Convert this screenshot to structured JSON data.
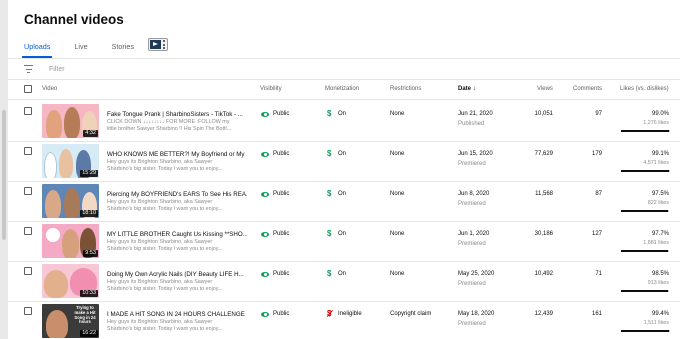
{
  "page": {
    "title": "Channel videos"
  },
  "tabs": [
    {
      "label": "Uploads",
      "active": true
    },
    {
      "label": "Live",
      "active": false
    },
    {
      "label": "Stories",
      "active": false
    }
  ],
  "filter": {
    "placeholder": "Filter"
  },
  "columns": {
    "video": "Video",
    "visibility": "Visibility",
    "monetization": "Monetization",
    "restrictions": "Restrictions",
    "date": "Date",
    "views": "Views",
    "comments": "Comments",
    "likes": "Likes (vs. dislikes)"
  },
  "colors": {
    "accent": "#065fd4",
    "green": "#0f9d58",
    "red": "#cc0000"
  },
  "rows": [
    {
      "title": "Fake Tongue Prank | SharbinoSisters - TikTok - ...",
      "desc1": "CLICK DOWN ↓↓↓↓↓↓↓↓ FOR MORE :FOLLOW my",
      "desc2": "little brother Sawyer Sharbino !! His Spin The Bottl...",
      "duration": "4:32",
      "visibility": "Public",
      "monetization": "On",
      "restrictions": "None",
      "date": "Jun 21, 2020",
      "status": "Published",
      "views": "10,051",
      "comments": "97",
      "likes_pct": "99.0%",
      "likes_count": "1,276 likes",
      "like_ratio": 0.99
    },
    {
      "title": "WHO KNOWS ME BETTER?! My Boyfriend or My ...",
      "desc1": "Hey guys its Brighton Sharbino, aka Sawyer",
      "desc2": "Sharbino's big sister. Today i want you to enjoy...",
      "duration": "15:29",
      "visibility": "Public",
      "monetization": "On",
      "restrictions": "None",
      "date": "Jun 15, 2020",
      "status": "Premiered",
      "views": "77,629",
      "comments": "179",
      "likes_pct": "99.1%",
      "likes_count": "4,571 likes",
      "like_ratio": 0.991
    },
    {
      "title": "Piercing My BOYFRIEND's EARS To See His REA...",
      "desc1": "Hey guys its Brighton Sharbino, aka Sawyer",
      "desc2": "Sharbino's big sister. Today i want you to enjoy...",
      "duration": "18:10",
      "visibility": "Public",
      "monetization": "On",
      "restrictions": "None",
      "date": "Jun 8, 2020",
      "status": "Premiered",
      "views": "11,568",
      "comments": "87",
      "likes_pct": "97.5%",
      "likes_count": "822 likes",
      "like_ratio": 0.975
    },
    {
      "title": "MY LITTLE BROTHER Caught Us Kissing **SHO...",
      "desc1": "Hey guys its Brighton Sharbino, aka Sawyer",
      "desc2": "Sharbino's big sister. Today i want you to enjoy...",
      "duration": "9:53",
      "visibility": "Public",
      "monetization": "On",
      "restrictions": "None",
      "date": "Jun 1, 2020",
      "status": "Premiered",
      "views": "30,186",
      "comments": "127",
      "likes_pct": "97.7%",
      "likes_count": "1,881 likes",
      "like_ratio": 0.977
    },
    {
      "title": "Doing My Own Acrylic Nails (DIY Beauty LIFE H...",
      "desc1": "Hey guys its Brighton Sharbino, aka Sawyer",
      "desc2": "Sharbino's big sister. Today i want you to enjoy...",
      "duration": "10:33",
      "visibility": "Public",
      "monetization": "On",
      "restrictions": "None",
      "date": "May 25, 2020",
      "status": "Premiered",
      "views": "10,492",
      "comments": "71",
      "likes_pct": "98.5%",
      "likes_count": "913 likes",
      "like_ratio": 0.985
    },
    {
      "title": "I MADE A HIT SONG IN 24 HOURS CHALLENGE ...",
      "desc1": "Hey guys its Brighton Sharbino, aka Sawyer",
      "desc2": "Sharbino's big sister. Today i want you to enjoy...",
      "duration": "16:22",
      "thumb_text": "Trying to make a Hit Song in 24 hours",
      "visibility": "Public",
      "monetization": "Ineligible",
      "restrictions": "Copyright claim",
      "date": "May 18, 2020",
      "status": "Premiered",
      "views": "12,439",
      "comments": "161",
      "likes_pct": "99.4%",
      "likes_count": "1,511 likes",
      "like_ratio": 0.994
    }
  ]
}
